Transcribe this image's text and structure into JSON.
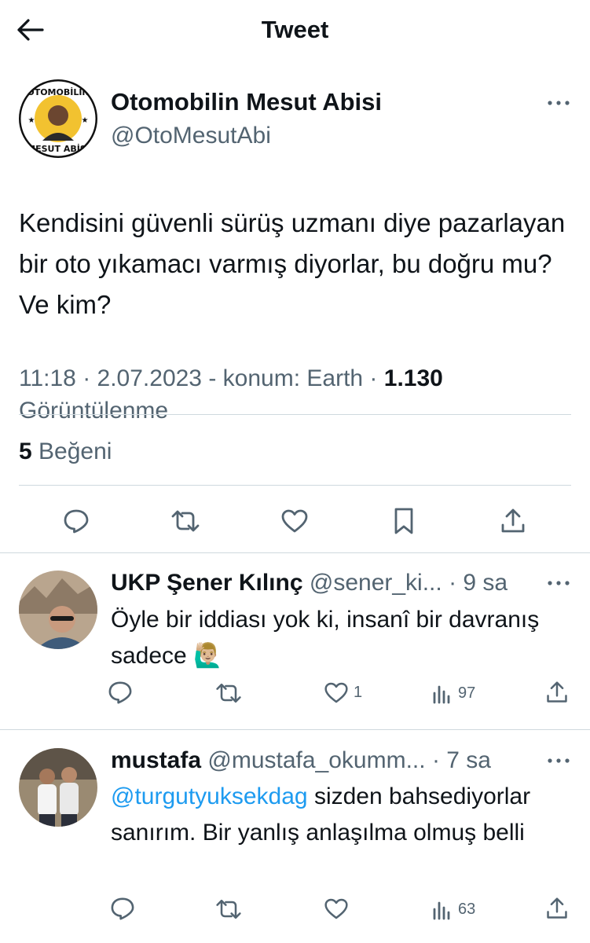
{
  "header": {
    "title": "Tweet",
    "back_icon": "arrow-left-icon"
  },
  "author": {
    "name": "Otomobilin Mesut Abisi",
    "handle": "@OtoMesutAbi",
    "avatar_text_top": "OTOMOBİLİN",
    "avatar_text_bottom": "MESUT ABİSİ"
  },
  "tweet": {
    "text": "Kendisini güvenli sürüş uzmanı diye pazarlayan bir oto yıkamacı varmış diyorlar, bu doğru mu? Ve kim?",
    "time": "11:18",
    "date": "2.07.2023",
    "location": "konum: Earth",
    "views": "1.130",
    "views_label": "Görüntülenme",
    "likes_count": "5",
    "likes_label": "Beğeni"
  },
  "replies": [
    {
      "name": "UKP Şener Kılınç",
      "handle": "@sener_ki...",
      "time": "9 sa",
      "text": "Öyle bir iddiası yok ki, insanî bir davranış sadece",
      "emoji": "🙋🏼‍♂️",
      "likes": "1",
      "views": "97"
    },
    {
      "name": "mustafa",
      "handle": "@mustafa_okumm...",
      "time": "7 sa",
      "mention": "@turgutyuksekdag",
      "text": "sizden bahsediyorlar sanırım. Bir yanlış anlaşılma olmuş belli",
      "views": "63"
    }
  ],
  "colors": {
    "text": "#0f1419",
    "muted": "#536471",
    "accent": "#1d9bf0",
    "divider": "#cfd9de"
  }
}
